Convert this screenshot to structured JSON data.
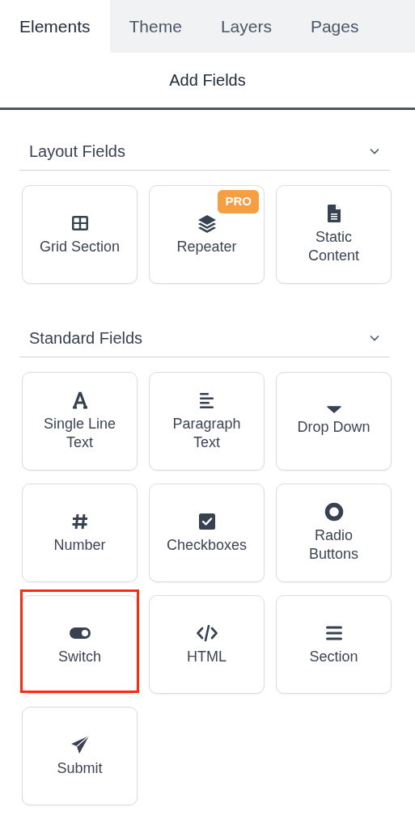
{
  "tabs": [
    {
      "label": "Elements",
      "selected": true
    },
    {
      "label": "Theme",
      "selected": false
    },
    {
      "label": "Layers",
      "selected": false
    },
    {
      "label": "Pages",
      "selected": false
    }
  ],
  "panel_title": "Add Fields",
  "sections": [
    {
      "title": "Layout Fields",
      "expanded": true,
      "fields": [
        {
          "kind": "grid",
          "label": "Grid Section",
          "highlighted": false
        },
        {
          "kind": "layers",
          "label": "Repeater",
          "badge": "PRO",
          "highlighted": false
        },
        {
          "kind": "document",
          "label": "Static Content",
          "highlighted": false
        }
      ]
    },
    {
      "title": "Standard Fields",
      "expanded": true,
      "fields": [
        {
          "kind": "letter",
          "label": "Single Line Text",
          "highlighted": false
        },
        {
          "kind": "paragraph",
          "label": "Paragraph Text",
          "highlighted": false
        },
        {
          "kind": "caret",
          "label": "Drop Down",
          "highlighted": false
        },
        {
          "kind": "hash",
          "label": "Number",
          "highlighted": false
        },
        {
          "kind": "checkbox",
          "label": "Checkboxes",
          "highlighted": false
        },
        {
          "kind": "radio",
          "label": "Radio Buttons",
          "highlighted": false
        },
        {
          "kind": "toggle",
          "label": "Switch",
          "highlighted": true
        },
        {
          "kind": "code",
          "label": "HTML",
          "highlighted": false
        },
        {
          "kind": "bars",
          "label": "Section",
          "highlighted": false
        },
        {
          "kind": "plane",
          "label": "Submit",
          "highlighted": false
        }
      ]
    }
  ]
}
